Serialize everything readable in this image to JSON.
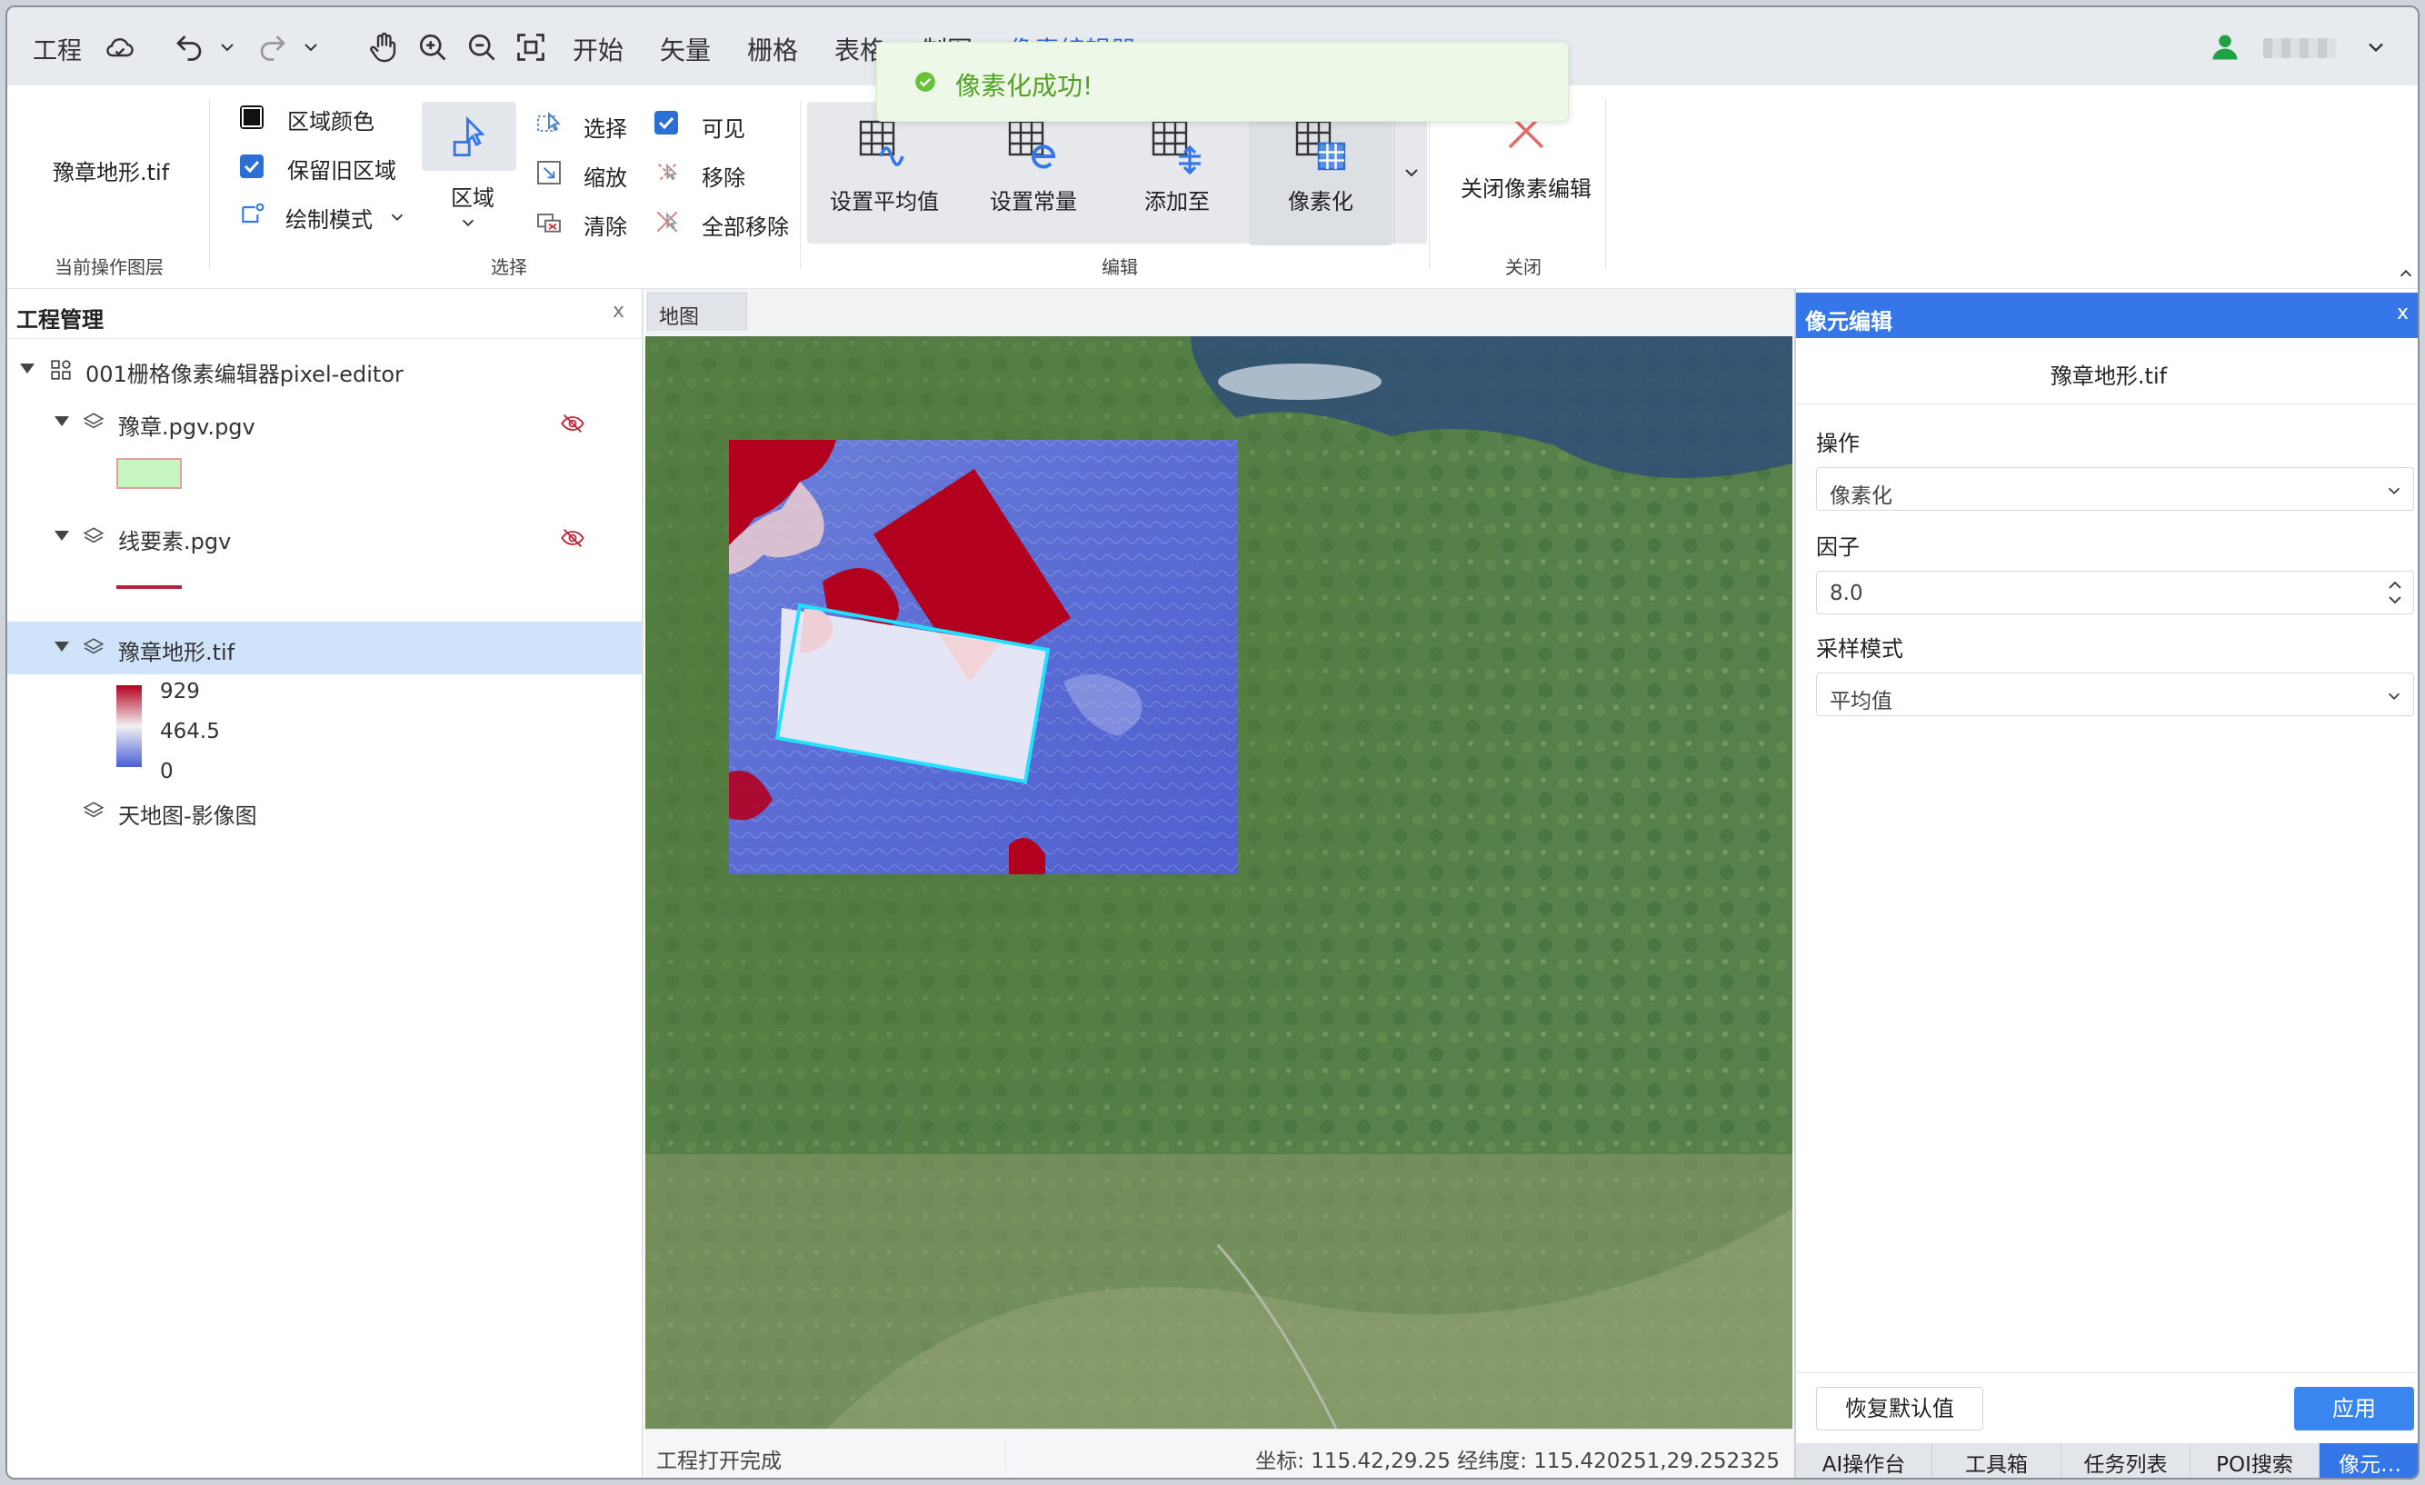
{
  "topbar": {
    "project_menu": "工程",
    "tabs": [
      {
        "label": "开始",
        "active": false
      },
      {
        "label": "矢量",
        "active": false
      },
      {
        "label": "栅格",
        "active": false
      },
      {
        "label": "表格",
        "active": false
      },
      {
        "label": "制图",
        "active": false
      },
      {
        "label": "像素编辑器",
        "active": true
      }
    ],
    "icons": [
      "cloud-icon",
      "undo-icon",
      "chevron-down-icon",
      "redo-icon",
      "chevron-down-icon",
      "pan-hand-icon",
      "zoom-in-icon",
      "zoom-out-icon",
      "full-extent-icon",
      "user-icon"
    ],
    "username": "",
    "accent_color": "#2f6bd9"
  },
  "toast": {
    "message": "像素化成功!",
    "color": "#52a324"
  },
  "ribbon": {
    "current_layer": {
      "value": "豫章地形.tif",
      "group_label": "当前操作图层"
    },
    "select_group": {
      "region_color_label": "区域颜色",
      "keep_old_region_label": "保留旧区域",
      "keep_old_region_checked": true,
      "draw_mode_label": "绘制模式",
      "region_button_label": "区域",
      "select_label": "选择",
      "zoom_label": "缩放",
      "clear_label": "清除",
      "visible_label": "可见",
      "visible_checked": true,
      "remove_label": "移除",
      "remove_all_label": "全部移除",
      "group_label": "选择"
    },
    "edit_group": {
      "buttons": [
        "设置平均值",
        "设置常量",
        "添加至",
        "像素化"
      ],
      "group_label": "编辑"
    },
    "close_group": {
      "button_label": "关闭像素编辑",
      "group_label": "关闭"
    }
  },
  "left_panel": {
    "title": "工程管理",
    "close": "x",
    "project_name": "001栅格像素编辑器pixel-editor",
    "layers": [
      {
        "name": "豫章.pgv.pgv",
        "legend_color": "#c6f5c0",
        "hidden": true
      },
      {
        "name": "线要素.pgv",
        "legend_color": "#b3243c",
        "hidden": true
      },
      {
        "name": "豫章地形.tif",
        "selected": true,
        "legend": {
          "max": "929",
          "mid": "464.5",
          "min": "0"
        }
      },
      {
        "name": "天地图-影像图"
      }
    ]
  },
  "map": {
    "tab_label": "地图",
    "status_left": "工程打开完成",
    "status_right": "坐标: 115.42,29.25 经纬度: 115.420251,29.252325"
  },
  "right_panel": {
    "title": "像元编辑",
    "close": "x",
    "file_name": "豫章地形.tif",
    "operation_label": "操作",
    "operation_value": "像素化",
    "factor_label": "因子",
    "factor_value": "8.0",
    "sampling_label": "采样模式",
    "sampling_value": "平均值",
    "reset_button": "恢复默认值",
    "apply_button": "应用",
    "bottom_tabs": [
      {
        "label": "AI操作台",
        "active": false
      },
      {
        "label": "工具箱",
        "active": false
      },
      {
        "label": "任务列表",
        "active": false
      },
      {
        "label": "POI搜索",
        "active": false
      },
      {
        "label": "像元…",
        "active": true
      }
    ]
  }
}
